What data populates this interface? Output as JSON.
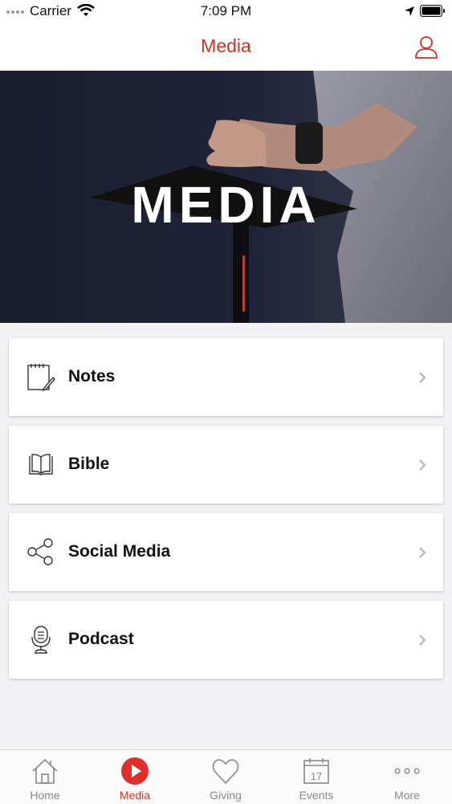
{
  "status_bar": {
    "carrier": "Carrier",
    "time": "7:09 PM"
  },
  "nav": {
    "title": "Media"
  },
  "hero": {
    "title": "MEDIA"
  },
  "menu": {
    "items": [
      {
        "label": "Notes",
        "icon": "notes-icon"
      },
      {
        "label": "Bible",
        "icon": "bible-icon"
      },
      {
        "label": "Social Media",
        "icon": "share-icon"
      },
      {
        "label": "Podcast",
        "icon": "microphone-icon"
      }
    ]
  },
  "tabs": {
    "items": [
      {
        "label": "Home",
        "icon": "home-icon",
        "active": false
      },
      {
        "label": "Media",
        "icon": "play-icon",
        "active": true
      },
      {
        "label": "Giving",
        "icon": "heart-icon",
        "active": false
      },
      {
        "label": "Events",
        "icon": "calendar-icon",
        "active": false,
        "badge": "17"
      },
      {
        "label": "More",
        "icon": "more-icon",
        "active": false
      }
    ]
  },
  "colors": {
    "accent": "#d63024",
    "background": "#f2f2f4",
    "inactive": "#888888"
  }
}
